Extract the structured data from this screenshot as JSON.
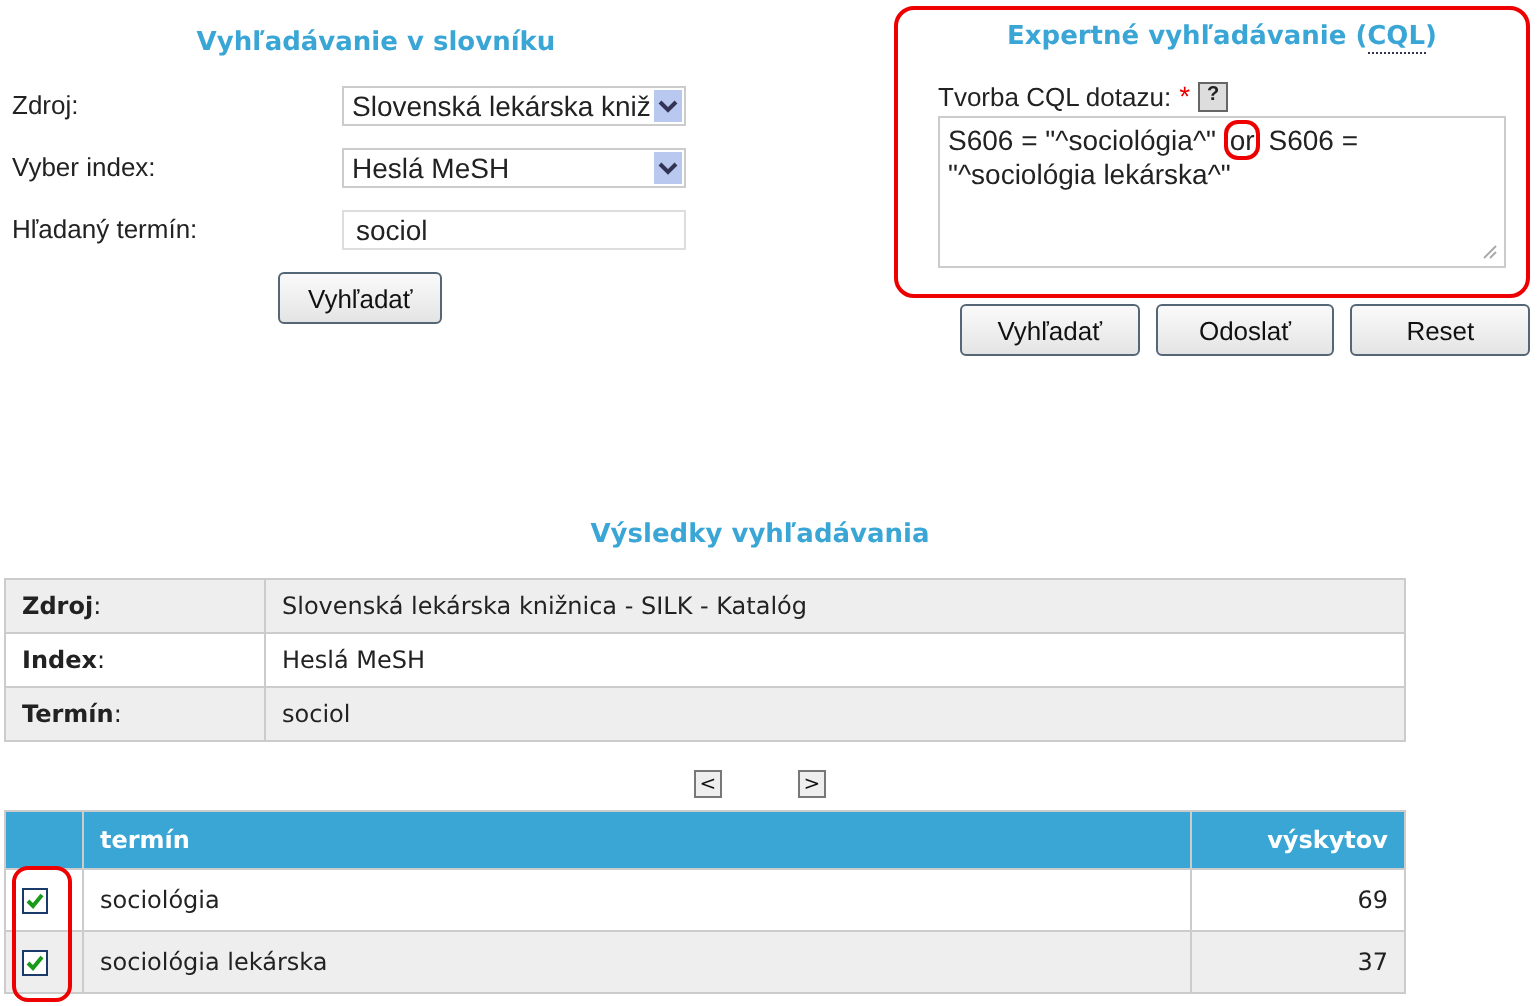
{
  "dictionary_search": {
    "title": "Vyhľadávanie v slovníku",
    "fields": [
      {
        "kind": "select",
        "label": "Zdroj:",
        "value": "Slovenská lekárska kniž"
      },
      {
        "kind": "select",
        "label": "Vyber index:",
        "value": "Heslá MeSH"
      },
      {
        "kind": "text",
        "label": "Hľadaný termín:",
        "value": "sociol"
      }
    ],
    "button": "Vyhľadať"
  },
  "expert_search": {
    "title": "Expertné vyhľadávanie (",
    "title_link": "CQL",
    "title_end": ")",
    "query_label": "Tvorba CQL dotazu:",
    "required_mark": "*",
    "help": "?",
    "query_parts": [
      {
        "text": "S606 = \"^sociológia^\"",
        "circled": false
      },
      {
        "text": "or",
        "circled": true
      },
      {
        "text": "S606 = \"^sociológia lekárska^\"",
        "circled": false
      }
    ],
    "buttons": [
      "Vyhľadať",
      "Odoslať",
      "Reset"
    ]
  },
  "results": {
    "title": "Výsledky vyhľadávania",
    "info": [
      {
        "label": "**Zdroj**:",
        "value": "Slovenská lekárska knižnica - SILK - Katalóg"
      },
      {
        "label": "**Index**:",
        "value": "Heslá MeSH"
      },
      {
        "label": "**Termín**:",
        "value": "sociol"
      }
    ],
    "pager": {
      "prev": "<",
      "next": ">"
    },
    "columns": [
      "termín",
      "výskytov"
    ],
    "rows": [
      {
        "term": "sociológia",
        "count": "69",
        "checked": true
      },
      {
        "term": "sociológia lekárska",
        "count": "37",
        "checked": true
      }
    ]
  }
}
